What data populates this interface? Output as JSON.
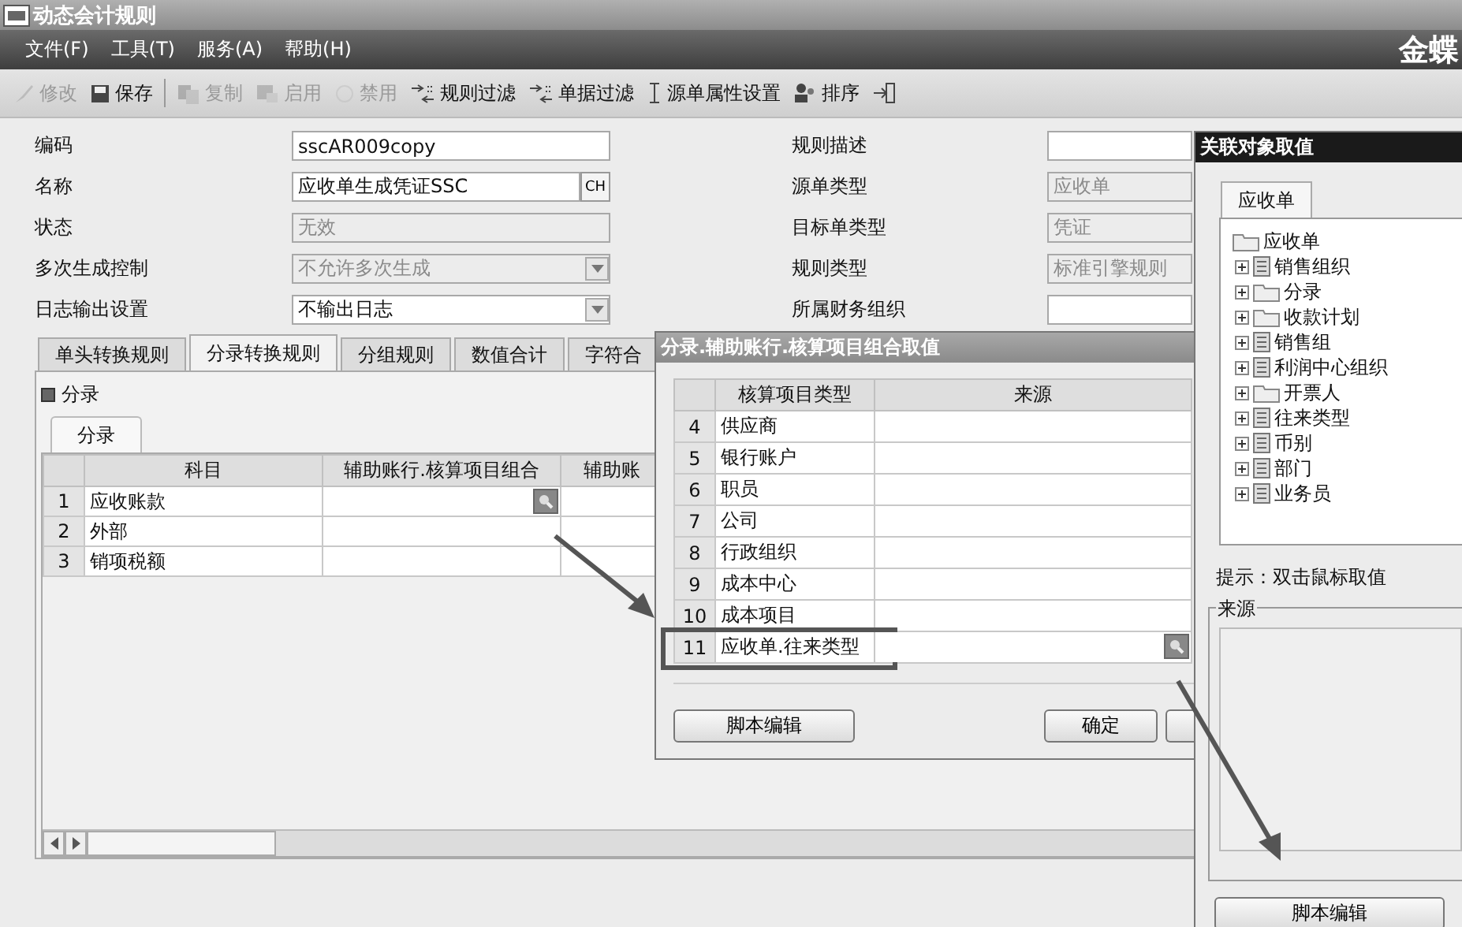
{
  "window": {
    "title": "动态会计规则",
    "brand": "金蝶"
  },
  "menu": [
    "文件(F)",
    "工具(T)",
    "服务(A)",
    "帮助(H)"
  ],
  "toolbar": [
    {
      "kind": "edit",
      "label": "修改",
      "disabled": true
    },
    {
      "kind": "save",
      "label": "保存",
      "disabled": false
    },
    {
      "kind": "copy",
      "label": "复制",
      "disabled": true
    },
    {
      "kind": "enable",
      "label": "启用",
      "disabled": true
    },
    {
      "kind": "disable",
      "label": "禁用",
      "disabled": true
    },
    {
      "kind": "filter",
      "label": "规则过滤",
      "disabled": false
    },
    {
      "kind": "filter",
      "label": "单据过滤",
      "disabled": false
    },
    {
      "kind": "attribute",
      "label": "源单属性设置",
      "disabled": false
    },
    {
      "kind": "sort",
      "label": "排序",
      "disabled": false
    },
    {
      "kind": "exit",
      "disabled": false
    }
  ],
  "form_left": [
    {
      "label": "编码",
      "value": "sscAR009copy",
      "kind": "text",
      "disabled": false
    },
    {
      "label": "名称",
      "value": "应收单生成凭证SSC",
      "kind": "lang",
      "lang": "CH",
      "disabled": false
    },
    {
      "label": "状态",
      "value": "无效",
      "kind": "text",
      "disabled": true
    },
    {
      "label": "多次生成控制",
      "value": "不允许多次生成",
      "kind": "select",
      "disabled": true
    },
    {
      "label": "日志输出设置",
      "value": "不输出日志",
      "kind": "select",
      "disabled": false
    }
  ],
  "form_right": [
    {
      "label": "规则描述",
      "disabled": false
    },
    {
      "label": "源单类型",
      "value": "应收单",
      "disabled": true
    },
    {
      "label": "目标单类型",
      "value": "凭证",
      "disabled": true
    },
    {
      "label": "规则类型",
      "value": "标准引擎规则",
      "disabled": true
    },
    {
      "label": "所属财务组织",
      "disabled": false
    }
  ],
  "tabs": [
    {
      "label": "单头转换规则",
      "selected": false
    },
    {
      "label": "分录转换规则",
      "selected": true
    },
    {
      "label": "分组规则",
      "selected": false
    },
    {
      "label": "数值合计",
      "selected": false
    },
    {
      "label": "字符合",
      "selected": false
    }
  ],
  "panel": {
    "title": "分录",
    "subtab": "分录",
    "columns": [
      "科目",
      "辅助账行.核算项目组合",
      "辅助账"
    ],
    "rows": [
      {
        "index": "1",
        "subject": "应收账款",
        "lookup": true
      },
      {
        "index": "2",
        "subject": "外部",
        "lookup": false
      },
      {
        "index": "3",
        "subject": "销项税额",
        "lookup": false
      }
    ]
  },
  "dialog": {
    "title": "分录.辅助账行.核算项目组合取值",
    "columns": [
      "核算项目类型",
      "来源"
    ],
    "rows": [
      {
        "index": "4",
        "type": "供应商",
        "lookup": false,
        "highlighted": false
      },
      {
        "index": "5",
        "type": "银行账户",
        "lookup": false,
        "highlighted": false
      },
      {
        "index": "6",
        "type": "职员",
        "lookup": false,
        "highlighted": false
      },
      {
        "index": "7",
        "type": "公司",
        "lookup": false,
        "highlighted": false
      },
      {
        "index": "8",
        "type": "行政组织",
        "lookup": false,
        "highlighted": false
      },
      {
        "index": "9",
        "type": "成本中心",
        "lookup": false,
        "highlighted": false
      },
      {
        "index": "10",
        "type": "成本项目",
        "lookup": false,
        "highlighted": false
      },
      {
        "index": "11",
        "type": "应收单.往来类型",
        "lookup": true,
        "highlighted": true
      }
    ],
    "buttons": [
      "脚本编辑",
      "确定"
    ]
  },
  "object_panel": {
    "title": "关联对象取值",
    "tab": "应收单",
    "tree": {
      "label": "应收单",
      "kind": "folder",
      "children": [
        {
          "label": "销售组织",
          "kind": "document",
          "expanded": false
        },
        {
          "label": "分录",
          "kind": "folder",
          "expanded": false
        },
        {
          "label": "收款计划",
          "kind": "folder",
          "expanded": false
        },
        {
          "label": "销售组",
          "kind": "document",
          "expanded": false
        },
        {
          "label": "利润中心组织",
          "kind": "document",
          "expanded": false
        },
        {
          "label": "开票人",
          "kind": "folder",
          "expanded": false
        },
        {
          "label": "往来类型",
          "kind": "document",
          "expanded": false
        },
        {
          "label": "币别",
          "kind": "document",
          "expanded": false
        },
        {
          "label": "部门",
          "kind": "document",
          "expanded": false
        },
        {
          "label": "业务员",
          "kind": "document",
          "expanded": false
        }
      ]
    },
    "hint": "提示：双击鼠标取值",
    "group": "来源",
    "button": "脚本编辑"
  }
}
